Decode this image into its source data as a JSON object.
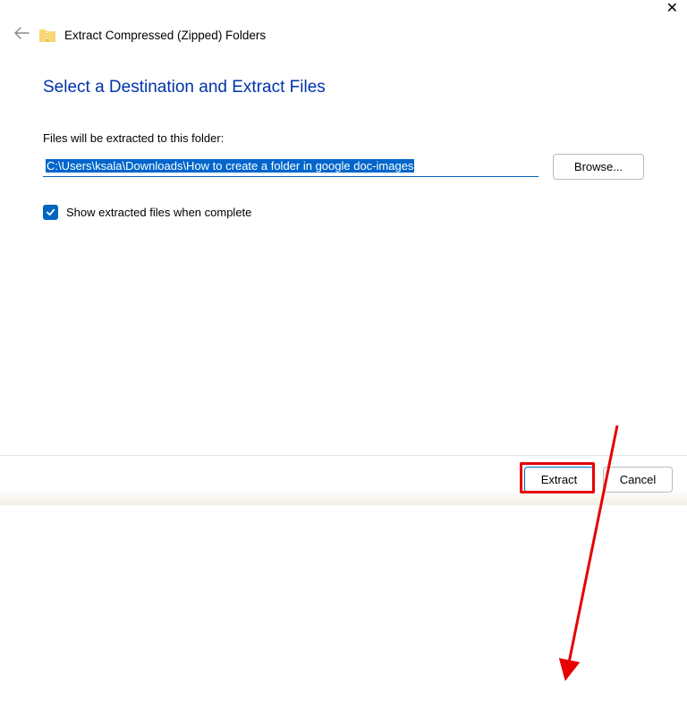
{
  "header": {
    "wizard_title": "Extract Compressed (Zipped) Folders"
  },
  "main": {
    "heading": "Select a Destination and Extract Files",
    "field_label": "Files will be extracted to this folder:",
    "path_value": "C:\\Users\\ksala\\Downloads\\How to create a folder in google doc-images",
    "browse_label": "Browse...",
    "checkbox_label": "Show extracted files when complete"
  },
  "footer": {
    "extract_label": "Extract",
    "cancel_label": "Cancel"
  }
}
